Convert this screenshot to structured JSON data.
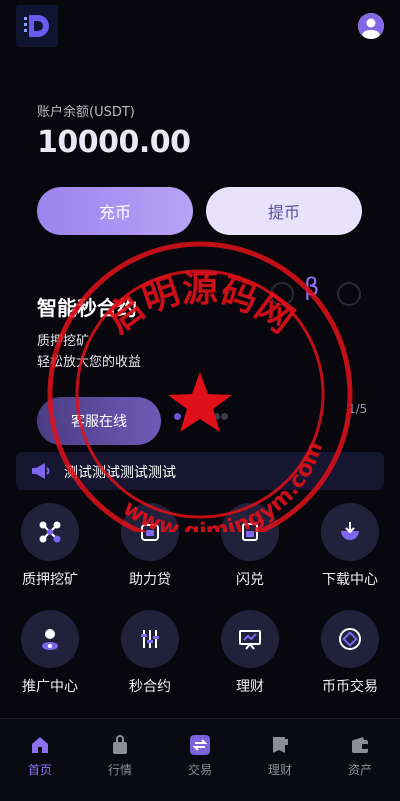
{
  "balance": {
    "label": "账户余额(USDT)",
    "value": "10000.00"
  },
  "actions": {
    "deposit": "充币",
    "withdraw": "提币"
  },
  "promo": {
    "title": "智能秒合约",
    "line1": "质押挖矿",
    "line2": "轻松放大您的收益",
    "cta": "客服在线",
    "page": "1/5",
    "beta_glyph": "β"
  },
  "notice": {
    "text": "测试测试测试测试"
  },
  "features": [
    {
      "label": "质押挖矿",
      "icon": "network-icon"
    },
    {
      "label": "助力贷",
      "icon": "loan-icon"
    },
    {
      "label": "闪兑",
      "icon": "swap-icon"
    },
    {
      "label": "下载中心",
      "icon": "download-icon"
    },
    {
      "label": "推广中心",
      "icon": "user-location-icon"
    },
    {
      "label": "秒合约",
      "icon": "sliders-icon"
    },
    {
      "label": "理财",
      "icon": "presentation-icon"
    },
    {
      "label": "币币交易",
      "icon": "coin-icon"
    }
  ],
  "tabs": [
    {
      "label": "首页",
      "icon": "home-icon",
      "active": true
    },
    {
      "label": "行情",
      "icon": "bag-icon",
      "active": false
    },
    {
      "label": "交易",
      "icon": "exchange-icon",
      "active": false
    },
    {
      "label": "理财",
      "icon": "finance-icon",
      "active": false
    },
    {
      "label": "资产",
      "icon": "wallet-icon",
      "active": false
    }
  ],
  "watermark": {
    "text_top": "启明源码网",
    "text_bottom": "www.qimingym.com"
  },
  "colors": {
    "accent": "#8b73f0",
    "background": "#08070d",
    "stamp": "#e0101a"
  }
}
